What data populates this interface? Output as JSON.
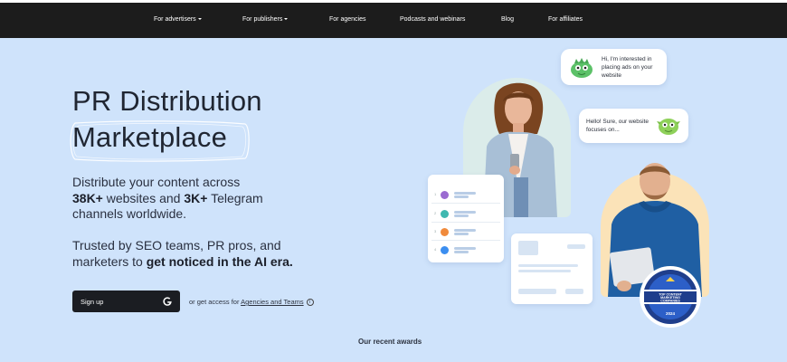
{
  "nav": {
    "items": [
      {
        "label": "For advertisers",
        "dropdown": true
      },
      {
        "label": "For publishers",
        "dropdown": true
      },
      {
        "label": "For agencies",
        "dropdown": false
      },
      {
        "label": "Podcasts and webinars",
        "dropdown": false
      },
      {
        "label": "Blog",
        "dropdown": false
      },
      {
        "label": "For affiliates",
        "dropdown": false
      }
    ]
  },
  "hero": {
    "title_line1": "PR Distribution",
    "title_line2": "Marketplace",
    "desc_line1": "Distribute your content across",
    "desc_line2_bold1": "38K+",
    "desc_line2_mid": " websites and ",
    "desc_line2_bold2": "3K+",
    "desc_line2_end": " Telegram",
    "desc_line3": "channels worldwide.",
    "trust_line1": "Trusted by SEO teams, PR pros, and",
    "trust_line2_start": "marketers to ",
    "trust_line2_bold": "get noticed in the AI era."
  },
  "cta": {
    "signup_label": "Sign up",
    "access_prefix": "or get access for ",
    "access_link": "Agencies and Teams"
  },
  "awards": {
    "heading": "Our recent awards"
  },
  "chat": {
    "bubble1": "Hi, I'm interested in placing ads on your website",
    "bubble2": "Hello! Sure, our website focuses on..."
  },
  "list_card": {
    "dots": [
      "#9b6bd1",
      "#3fb8b0",
      "#f08a3c",
      "#3b8ef0"
    ]
  },
  "badge": {
    "line1": "TOP CONTENT",
    "line2": "MARKETING",
    "line3": "COMPANIES",
    "year": "2024"
  },
  "colors": {
    "background": "#cfe3fb",
    "nav_bg": "#1c1c1c",
    "button_bg": "#1b1d22"
  }
}
